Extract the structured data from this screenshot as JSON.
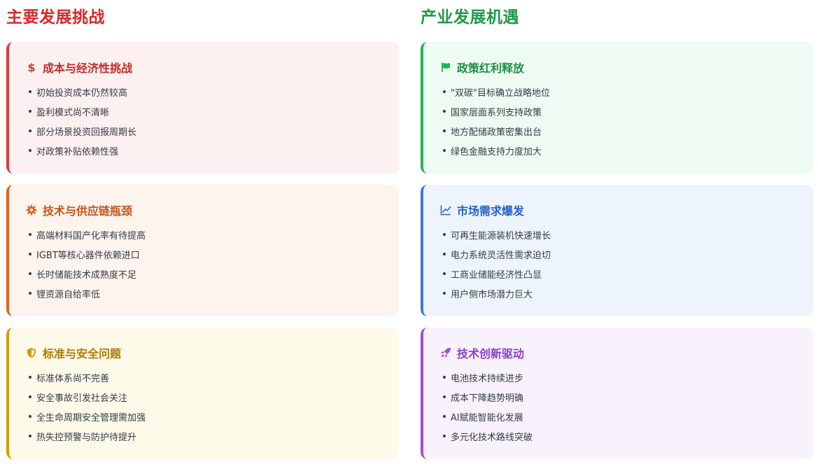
{
  "challenges": {
    "title": "主要发展挑战",
    "title_color": "#d72a2a",
    "cards": [
      {
        "title": "成本与经济性挑战",
        "icon": "dollar-icon",
        "accent": "#d93b3b",
        "bg": "#fdf0f0",
        "items": [
          "初始投资成本仍然较高",
          "盈利模式尚不清晰",
          "部分场景投资回报周期长",
          "对政策补贴依赖性强"
        ]
      },
      {
        "title": "技术与供应链瓶颈",
        "icon": "gear-icon",
        "accent": "#e2621b",
        "bg": "#fdf4ee",
        "items": [
          "高端材料国产化率有待提高",
          "IGBT等核心器件依赖进口",
          "长时储能技术成熟度不足",
          "锂资源自给率低"
        ]
      },
      {
        "title": "标准与安全问题",
        "icon": "shield-icon",
        "accent": "#d69b00",
        "bg": "#fefaea",
        "items": [
          "标准体系尚不完善",
          "安全事故引发社会关注",
          "全生命周期安全管理需加强",
          "热失控预警与防护待提升"
        ]
      }
    ]
  },
  "opportunities": {
    "title": "产业发展机遇",
    "title_color": "#1f9a45",
    "cards": [
      {
        "title": "政策红利释放",
        "icon": "flag-icon",
        "accent": "#22b25a",
        "bg": "#eefbf2",
        "items": [
          "\"双碳\"目标确立战略地位",
          "国家层面系列支持政策",
          "地方配储政策密集出台",
          "绿色金融支持力度加大"
        ]
      },
      {
        "title": "市场需求爆发",
        "icon": "chart-line-icon",
        "accent": "#3a78e0",
        "bg": "#eef4fd",
        "items": [
          "可再生能源装机快速增长",
          "电力系统灵活性需求迫切",
          "工商业储能经济性凸显",
          "用户侧市场潜力巨大"
        ]
      },
      {
        "title": "技术创新驱动",
        "icon": "rocket-icon",
        "accent": "#9a4fe0",
        "bg": "#f8f2fd",
        "items": [
          "电池技术持续进步",
          "成本下降趋势明确",
          "AI赋能智能化发展",
          "多元化技术路线突破"
        ]
      }
    ]
  }
}
